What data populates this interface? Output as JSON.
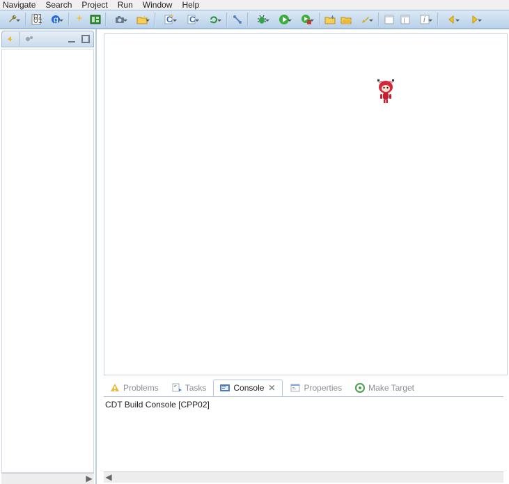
{
  "menu": {
    "items": [
      "Navigate",
      "Search",
      "Project",
      "Run",
      "Window",
      "Help"
    ]
  },
  "bottom": {
    "tabs": {
      "problems": "Problems",
      "tasks": "Tasks",
      "console": "Console",
      "properties": "Properties",
      "maketarget": "Make Target"
    },
    "active": "console",
    "console_text": "CDT Build Console [CPP02]"
  }
}
